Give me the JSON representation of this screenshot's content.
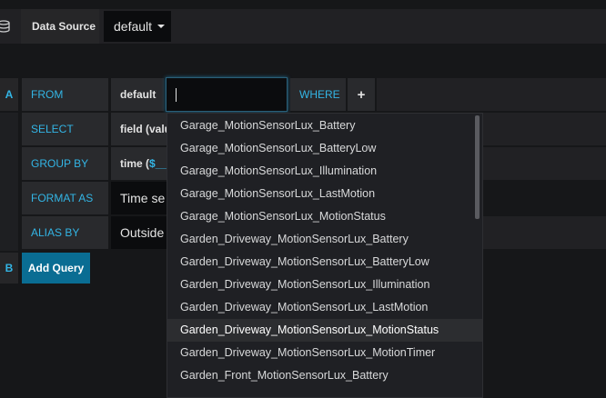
{
  "datasource": {
    "label": "Data Source",
    "value": "default"
  },
  "query_a": {
    "letter": "A",
    "from_label": "FROM",
    "from_policy": "default",
    "measurement_input_value": "",
    "where_label": "WHERE",
    "add_where_label": "+",
    "select_label": "SELECT",
    "select_value": "field (valu",
    "groupby_label": "GROUP BY",
    "groupby_value_prefix": "time (",
    "groupby_value_var": "$__",
    "format_label": "FORMAT AS",
    "format_value": "Time se",
    "alias_label": "ALIAS BY",
    "alias_value": "Outside"
  },
  "query_b": {
    "letter": "B",
    "add_query_label": "Add Query"
  },
  "measurement_dropdown": {
    "items": [
      "Garage_MotionSensorLux_Battery",
      "Garage_MotionSensorLux_BatteryLow",
      "Garage_MotionSensorLux_Illumination",
      "Garage_MotionSensorLux_LastMotion",
      "Garage_MotionSensorLux_MotionStatus",
      "Garden_Driveway_MotionSensorLux_Battery",
      "Garden_Driveway_MotionSensorLux_BatteryLow",
      "Garden_Driveway_MotionSensorLux_Illumination",
      "Garden_Driveway_MotionSensorLux_LastMotion",
      "Garden_Driveway_MotionSensorLux_MotionStatus",
      "Garden_Driveway_MotionSensorLux_MotionTimer",
      "Garden_Front_MotionSensorLux_Battery"
    ],
    "highlighted_index": 9
  },
  "colors": {
    "accent": "#33b5e5",
    "add_query_button": "#0a6d93",
    "background": "#161719"
  }
}
